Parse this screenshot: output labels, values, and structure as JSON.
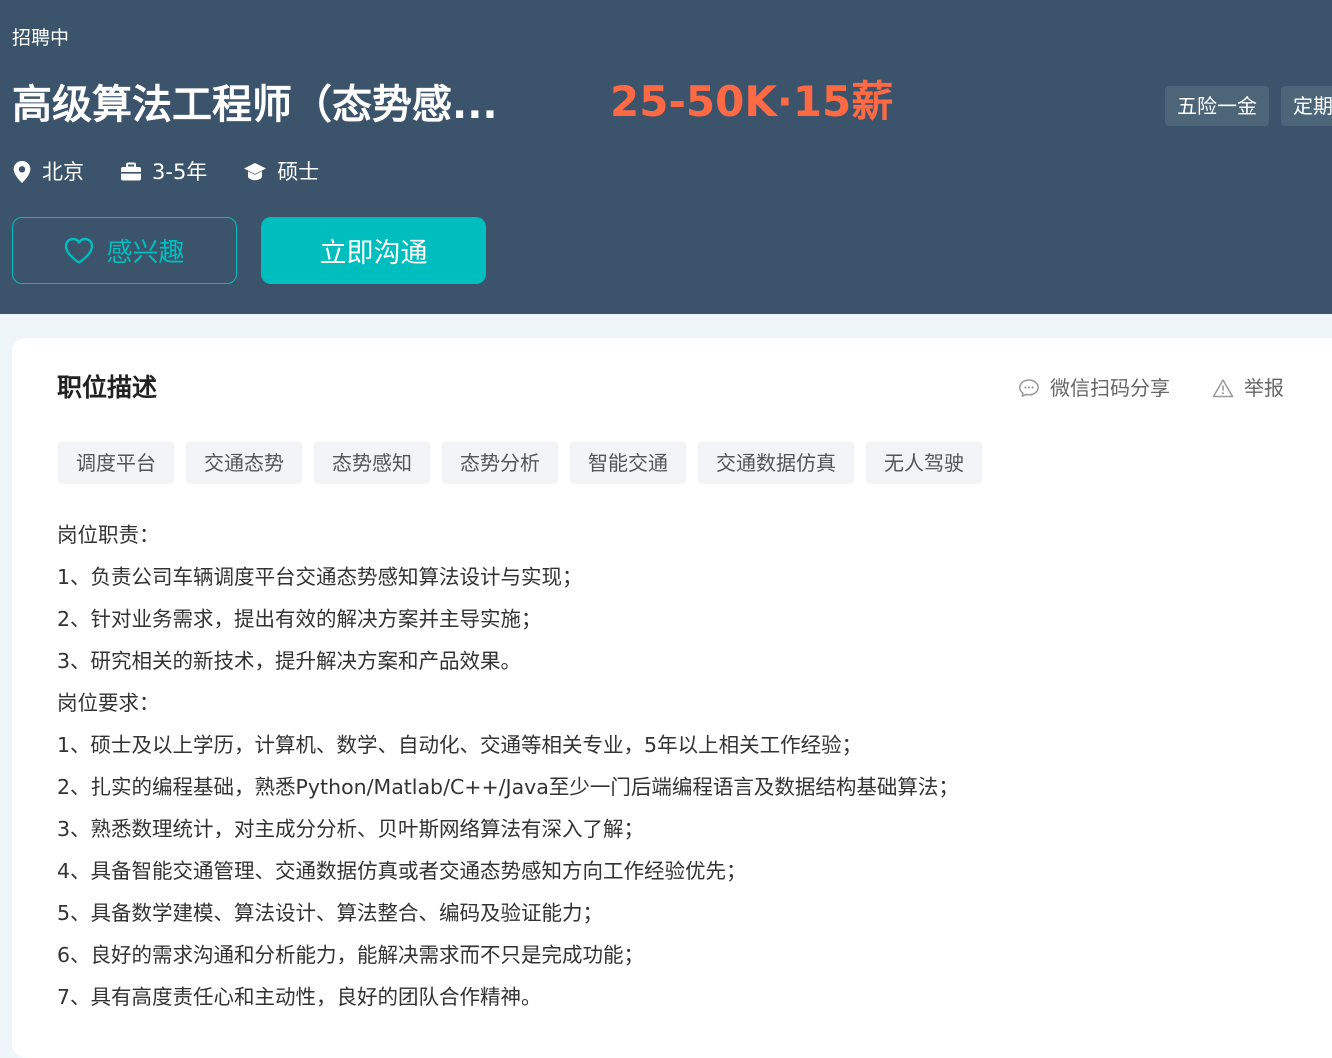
{
  "header": {
    "status": "招聘中",
    "title": "高级算法工程师（态势感...",
    "salary": "25-50K·15薪",
    "welfare": [
      "五险一金",
      "定期"
    ],
    "location": "北京",
    "experience": "3-5年",
    "degree": "硕士",
    "interest_label": "感兴趣",
    "chat_label": "立即沟通"
  },
  "card": {
    "title": "职位描述",
    "share_label": "微信扫码分享",
    "report_label": "举报",
    "tags": [
      "调度平台",
      "交通态势",
      "态势感知",
      "态势分析",
      "智能交通",
      "交通数据仿真",
      "无人驾驶"
    ],
    "lines": [
      "岗位职责：",
      "1、负责公司车辆调度平台交通态势感知算法设计与实现；",
      "2、针对业务需求，提出有效的解决方案并主导实施；",
      "3、研究相关的新技术，提升解决方案和产品效果。",
      "岗位要求：",
      "1、硕士及以上学历，计算机、数学、自动化、交通等相关专业，5年以上相关工作经验；",
      "2、扎实的编程基础，熟悉Python/Matlab/C++/Java至少一门后端编程语言及数据结构基础算法；",
      "3、熟悉数理统计，对主成分分析、贝叶斯网络算法有深入了解；",
      "4、具备智能交通管理、交通数据仿真或者交通态势感知方向工作经验优先；",
      "5、具备数学建模、算法设计、算法整合、编码及验证能力；",
      "6、良好的需求沟通和分析能力，能解决需求而不只是完成功能；",
      "7、具有高度责任心和主动性，良好的团队合作精神。"
    ]
  },
  "colors": {
    "header_bg": "#3b546b",
    "accent": "#00bebd",
    "salary": "#ff6a45"
  }
}
